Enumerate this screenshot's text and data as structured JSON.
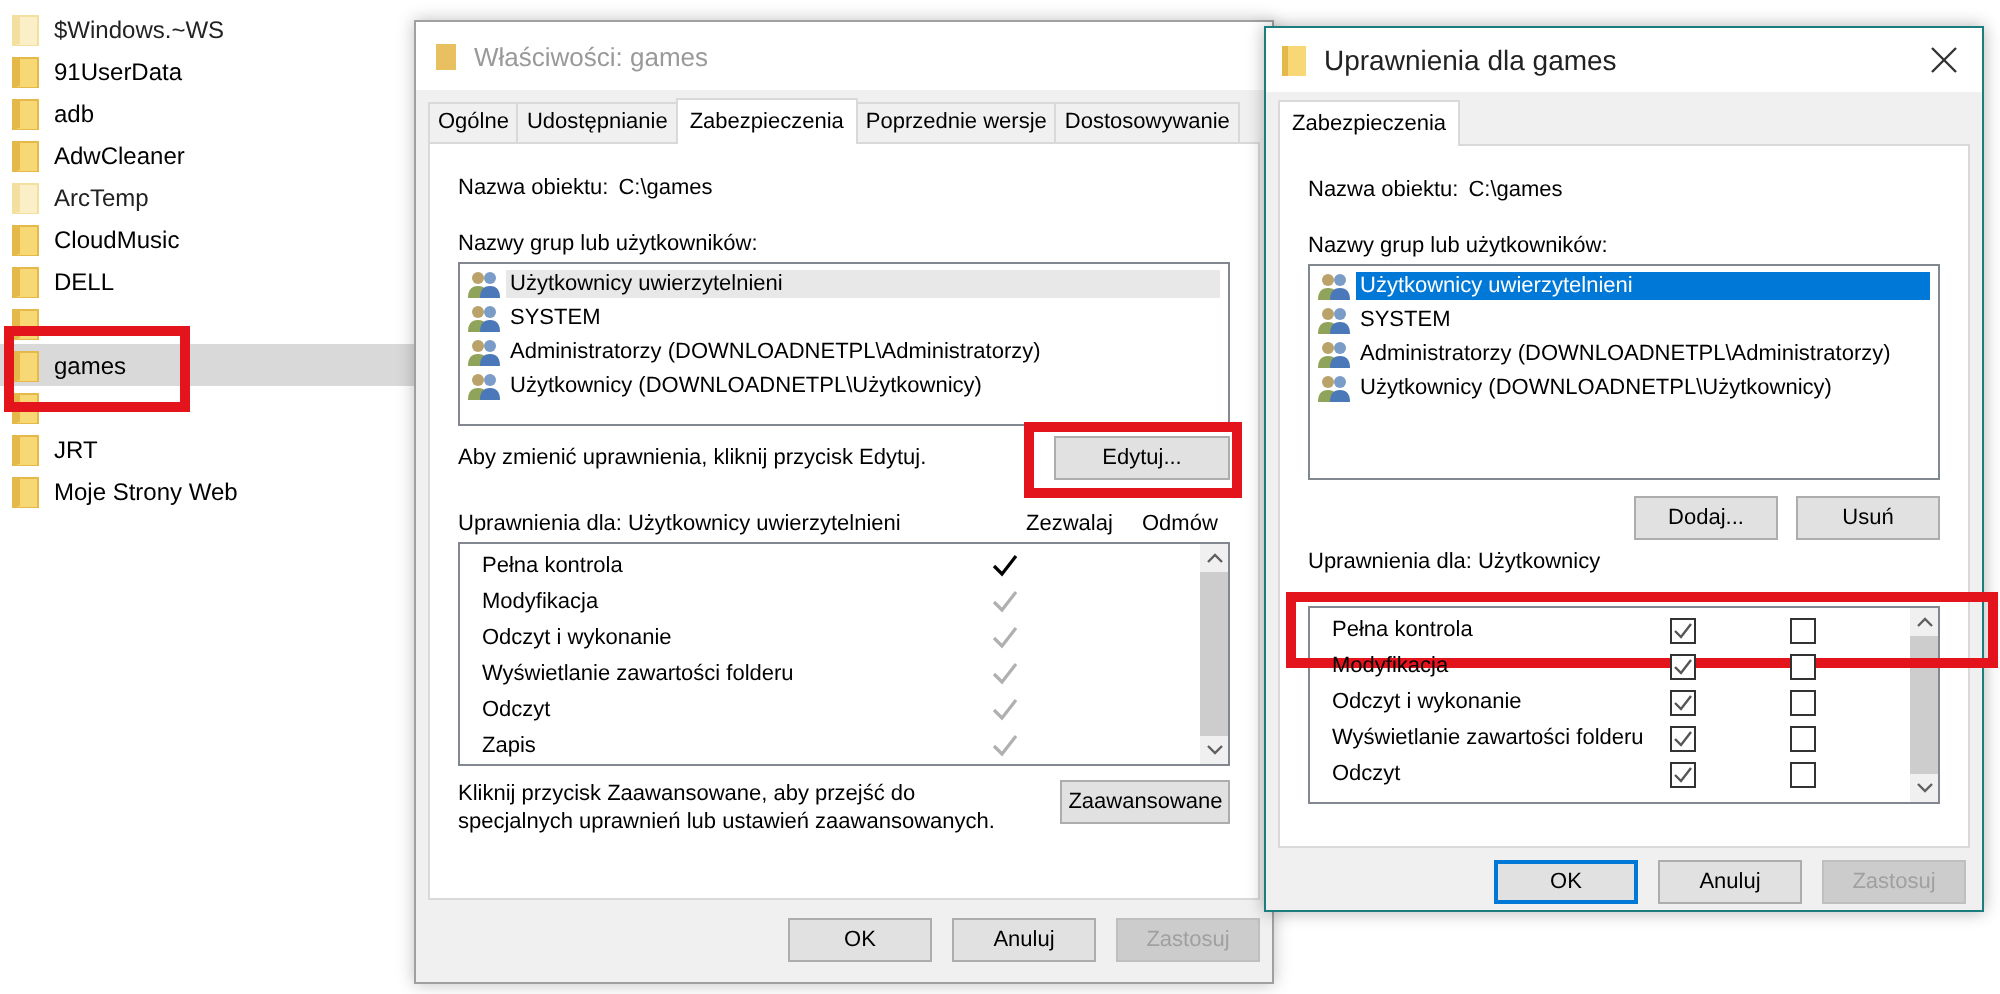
{
  "explorer": {
    "items": [
      {
        "label": "$Windows.~WS",
        "kind": "folder",
        "faded": true,
        "selected": false,
        "highlighted": false
      },
      {
        "label": "91UserData",
        "kind": "folder",
        "faded": false,
        "selected": false,
        "highlighted": false
      },
      {
        "label": "adb",
        "kind": "folder",
        "faded": false,
        "selected": false,
        "highlighted": false
      },
      {
        "label": "AdwCleaner",
        "kind": "folder",
        "faded": false,
        "selected": false,
        "highlighted": false
      },
      {
        "label": "ArcTemp",
        "kind": "folder",
        "faded": true,
        "selected": false,
        "highlighted": false
      },
      {
        "label": "CloudMusic",
        "kind": "folder",
        "faded": false,
        "selected": false,
        "highlighted": false
      },
      {
        "label": "DELL",
        "kind": "folder",
        "faded": false,
        "selected": false,
        "highlighted": false
      },
      {
        "kind": "obscured",
        "faded": false,
        "selected": false,
        "highlighted": false
      },
      {
        "label": "games",
        "kind": "folder",
        "faded": false,
        "selected": true,
        "highlighted": true
      },
      {
        "kind": "obscured",
        "faded": false,
        "selected": false,
        "highlighted": false
      },
      {
        "label": "JRT",
        "kind": "folder",
        "faded": false,
        "selected": false,
        "highlighted": false
      },
      {
        "label": "Moje Strony Web",
        "kind": "folder",
        "faded": false,
        "selected": false,
        "highlighted": false
      }
    ]
  },
  "properties_dialog": {
    "title": "Właściwości: games",
    "tabs": [
      {
        "label": "Ogólne",
        "selected": false
      },
      {
        "label": "Udostępnianie",
        "selected": false
      },
      {
        "label": "Zabezpieczenia",
        "selected": true
      },
      {
        "label": "Poprzednie wersje",
        "selected": false
      },
      {
        "label": "Dostosowywanie",
        "selected": false
      }
    ],
    "object_label": "Nazwa obiektu:",
    "object_value": "C:\\games",
    "groups_label": "Nazwy grup lub użytkowników:",
    "groups": [
      {
        "label": "Użytkownicy uwierzytelnieni",
        "selected": true
      },
      {
        "label": "SYSTEM",
        "selected": false
      },
      {
        "label": "Administratorzy (DOWNLOADNETPL\\Administratorzy)",
        "selected": false
      },
      {
        "label": "Użytkownicy (DOWNLOADNETPL\\Użytkownicy)",
        "selected": false
      }
    ],
    "edit_hint": "Aby zmienić uprawnienia, kliknij przycisk Edytuj.",
    "edit_button": {
      "label": "Edytuj...",
      "highlighted": true
    },
    "permissions_label": "Uprawnienia dla: Użytkownicy uwierzytelnieni",
    "allow_heading": "Zezwalaj",
    "deny_heading": "Odmów",
    "permissions": [
      {
        "name": "Pełna kontrola",
        "allow": true,
        "inherited": false,
        "deny": false
      },
      {
        "name": "Modyfikacja",
        "allow": true,
        "inherited": true,
        "deny": false
      },
      {
        "name": "Odczyt i wykonanie",
        "allow": true,
        "inherited": true,
        "deny": false
      },
      {
        "name": "Wyświetlanie zawartości folderu",
        "allow": true,
        "inherited": true,
        "deny": false
      },
      {
        "name": "Odczyt",
        "allow": true,
        "inherited": true,
        "deny": false
      },
      {
        "name": "Zapis",
        "allow": true,
        "inherited": true,
        "deny": false
      }
    ],
    "advanced_hint": "Kliknij przycisk Zaawansowane, aby przejść do specjalnych uprawnień lub ustawień zaawansowanych.",
    "advanced_button": "Zaawansowane",
    "buttons": [
      {
        "label": "OK",
        "disabled": false,
        "default": false
      },
      {
        "label": "Anuluj",
        "disabled": false,
        "default": false
      },
      {
        "label": "Zastosuj",
        "disabled": true,
        "default": false
      }
    ]
  },
  "permissions_dialog": {
    "title": "Uprawnienia dla games",
    "tabs": [
      {
        "label": "Zabezpieczenia",
        "selected": true
      }
    ],
    "object_label": "Nazwa obiektu:",
    "object_value": "C:\\games",
    "groups_label": "Nazwy grup lub użytkowników:",
    "groups": [
      {
        "label": "Użytkownicy uwierzytelnieni",
        "selected": true
      },
      {
        "label": "SYSTEM",
        "selected": false
      },
      {
        "label": "Administratorzy (DOWNLOADNETPL\\Administratorzy)",
        "selected": false
      },
      {
        "label": "Użytkownicy (DOWNLOADNETPL\\Użytkownicy)",
        "selected": false
      }
    ],
    "add_button": "Dodaj...",
    "remove_button": "Usuń",
    "permissions_label": "Uprawnienia dla: Użytkownicy",
    "permissions": [
      {
        "name": "Pełna kontrola",
        "allow": true,
        "deny": false,
        "highlighted": true
      },
      {
        "name": "Modyfikacja",
        "allow": true,
        "deny": false,
        "highlighted": false
      },
      {
        "name": "Odczyt i wykonanie",
        "allow": true,
        "deny": false,
        "highlighted": false
      },
      {
        "name": "Wyświetlanie zawartości folderu",
        "allow": true,
        "deny": false,
        "highlighted": false
      },
      {
        "name": "Odczyt",
        "allow": true,
        "deny": false,
        "highlighted": false
      }
    ],
    "buttons": [
      {
        "label": "OK",
        "disabled": false,
        "default": true
      },
      {
        "label": "Anuluj",
        "disabled": false,
        "default": false
      },
      {
        "label": "Zastosuj",
        "disabled": true,
        "default": false
      }
    ]
  }
}
